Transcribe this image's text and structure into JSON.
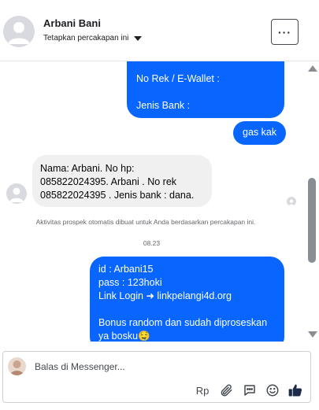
{
  "header": {
    "name": "Arbani Bani",
    "subtitle": "Tetapkan percakapan ini",
    "more_label": "···"
  },
  "messages": {
    "out_1": "No Rek / E-Wallet :\n\nJenis Bank :",
    "out_2": "gas kak",
    "in_1": "Nama: Arbani. No hp: 085822024395. Arbani . No rek 085822024395 . Jenis bank : dana.",
    "system_note": "Aktivitas prospek otomatis dibuat untuk Anda berdasarkan percakapan ini.",
    "timestamp": "08.23",
    "out_3": "id : Arbani15\npass : 123hoki\nLink Login ➜ linkpelangi4d.org\n\nBonus random dan sudah diproseskan ya bosku🤤"
  },
  "composer": {
    "placeholder": "Balas di Messenger...",
    "reply_label": "Rp"
  },
  "icons": {
    "attach": "paperclip-icon",
    "saved_replies": "chat-bubble-icon",
    "emoji": "smiley-icon",
    "like": "thumbs-up-icon"
  },
  "colors": {
    "outgoing_bubble": "#0866ff",
    "incoming_bubble": "#f0f0f0",
    "like_icon": "#1c2b4a"
  }
}
